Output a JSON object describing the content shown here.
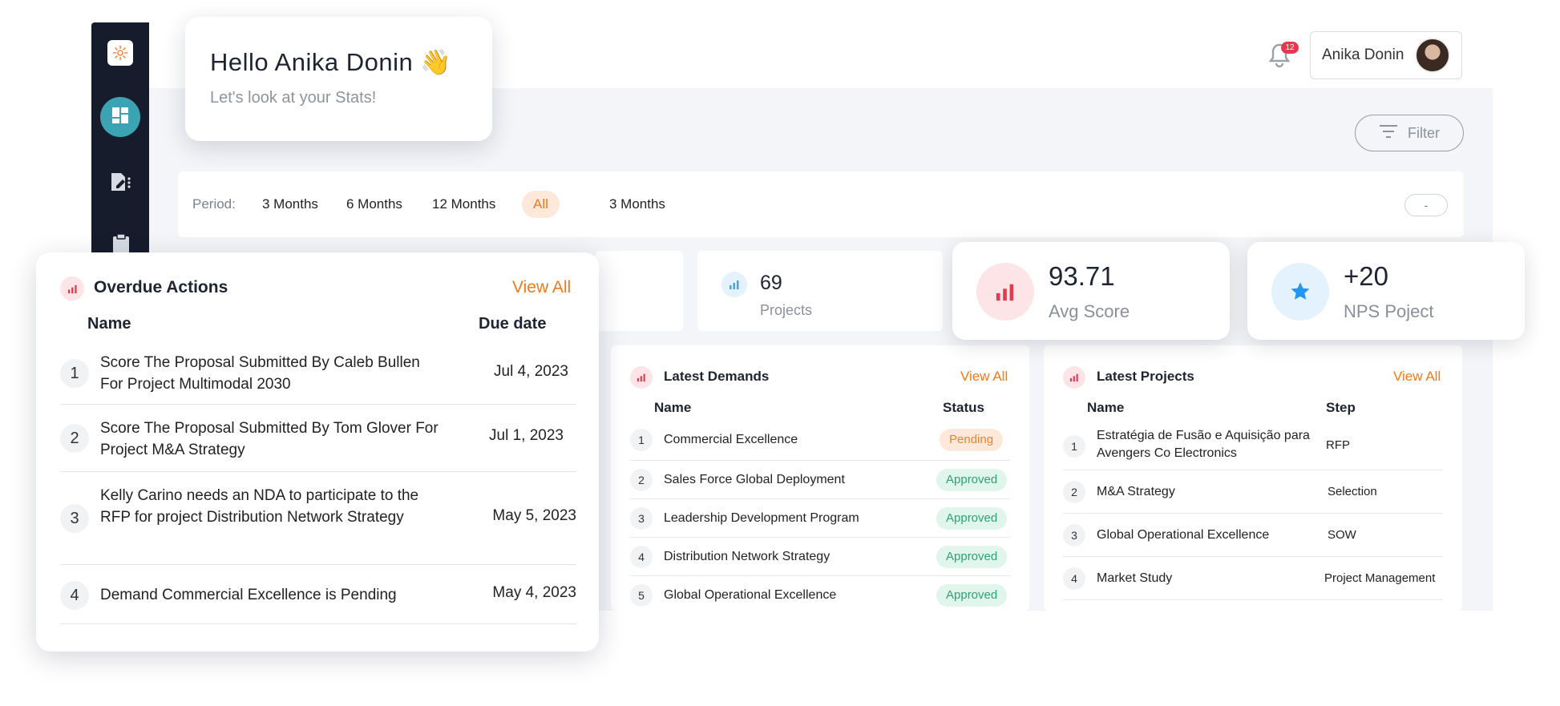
{
  "greeting": {
    "title": "Hello Anika Donin 👋",
    "subtitle": "Let's look at your Stats!"
  },
  "header": {
    "user_name": "Anika Donin",
    "notification_count": "12"
  },
  "filter": {
    "label": "Filter"
  },
  "period": {
    "label": "Period:",
    "options": [
      "3 Months",
      "6 Months",
      "12 Months",
      "All",
      "3 Months"
    ],
    "active": "All",
    "range": "-"
  },
  "stats": {
    "projects": {
      "value": "69",
      "label": "Projects"
    },
    "avg_score": {
      "value": "93.71",
      "label": "Avg Score"
    },
    "nps": {
      "value": "+20",
      "label": "NPS Poject"
    }
  },
  "overdue": {
    "title": "Overdue Actions",
    "view_all": "View All",
    "col_name": "Name",
    "col_due": "Due date",
    "rows": [
      {
        "num": "1",
        "name": "Score The Proposal Submitted By Caleb Bullen For Project Multimodal 2030",
        "date": "Jul 4, 2023"
      },
      {
        "num": "2",
        "name": "Score The Proposal Submitted By Tom Glover For Project M&A Strategy",
        "date": "Jul 1, 2023"
      },
      {
        "num": "3",
        "name": "Kelly Carino needs an NDA to participate to the RFP for project Distribution Network Strategy",
        "date": "May 5, 2023"
      },
      {
        "num": "4",
        "name": "Demand Commercial Excellence is Pending",
        "date": "May 4, 2023"
      }
    ]
  },
  "demands": {
    "title": "Latest Demands",
    "view_all": "View All",
    "col_name": "Name",
    "col_status": "Status",
    "rows": [
      {
        "num": "1",
        "name": "Commercial Excellence",
        "status": "Pending"
      },
      {
        "num": "2",
        "name": "Sales Force Global Deployment",
        "status": "Approved"
      },
      {
        "num": "3",
        "name": "Leadership Development Program",
        "status": "Approved"
      },
      {
        "num": "4",
        "name": "Distribution Network Strategy",
        "status": "Approved"
      },
      {
        "num": "5",
        "name": "Global Operational Excellence",
        "status": "Approved"
      }
    ]
  },
  "projects": {
    "title": "Latest Projects",
    "view_all": "View All",
    "col_name": "Name",
    "col_step": "Step",
    "rows": [
      {
        "num": "1",
        "name": "Estratégia de Fusão e Aquisição para Avengers Co Electronics",
        "step": "RFP"
      },
      {
        "num": "2",
        "name": "M&A Strategy",
        "step": "Selection"
      },
      {
        "num": "3",
        "name": "Global Operational Excellence",
        "step": "SOW"
      },
      {
        "num": "4",
        "name": "Market Study",
        "step": "Project Management"
      }
    ]
  },
  "colors": {
    "accent": "#f07a1a",
    "teal": "#3aa4b2",
    "sidebar": "#161c2b"
  },
  "icons": [
    "logo-icon",
    "dashboard-icon",
    "document-icon",
    "clipboard-icon",
    "bell-icon",
    "filter-icon",
    "chart-bars-icon",
    "star-icon"
  ]
}
